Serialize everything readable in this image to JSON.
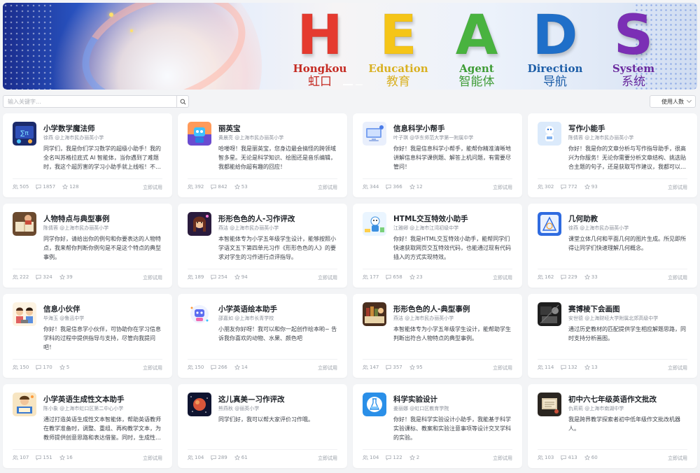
{
  "banner": {
    "letters": [
      {
        "big": "H",
        "en": "Hongkou",
        "zh": "虹口",
        "color": "#e53a2f",
        "en_color": "#c42a22",
        "zh_color": "#c42a22"
      },
      {
        "big": "E",
        "en": "Education",
        "zh": "教育",
        "color": "#f5c518",
        "en_color": "#d9b020",
        "zh_color": "#d9b020"
      },
      {
        "big": "A",
        "en": "Agent",
        "zh": "智能体",
        "color": "#49b33f",
        "en_color": "#3f9c36",
        "zh_color": "#3f9c36"
      },
      {
        "big": "D",
        "en": "Direction",
        "zh": "导航",
        "color": "#1f6fc9",
        "en_color": "#1d5ea8",
        "zh_color": "#1d5ea8"
      },
      {
        "big": "S",
        "en": "System",
        "zh": "系统",
        "color": "#7b2fb5",
        "en_color": "#6a2a9e",
        "zh_color": "#6a2a9e"
      }
    ]
  },
  "search": {
    "placeholder": "输入关键字..."
  },
  "sort": {
    "label": "使用人数"
  },
  "try_label": "立即试用",
  "cards": [
    {
      "title": "小学数学魔法师",
      "author": "徐燕 @上海市民办丽英小学",
      "desc": "同学们，我是你们学习数学的超级小助手！我的全名叫苏格拉底式 AI 智能体，当你遇到了难题时，我这个超厉害的学习小助手就上线啦！不过...",
      "views": "505",
      "msgs": "1857",
      "stars": "128",
      "icon": "math"
    },
    {
      "title": "丽英宝",
      "author": "黄晨亮 @上海市民办丽英小学",
      "desc": "哈喽呀！我是丽英宝，您身边最会搞怪的跨领域智多星。无论是科学知识、绘图还是音乐编辑，我都能给你超有趣的回应！",
      "views": "392",
      "msgs": "842",
      "stars": "53",
      "icon": "robot"
    },
    {
      "title": "信息科学小帮手",
      "author": "叶子琪 @华东师范大学第一附属中学",
      "desc": "你好！我是信息科学小帮手，能帮你精准清晰地讲解信息科学课例题、解答上机问题，有需要尽管问！",
      "views": "344",
      "msgs": "366",
      "stars": "12",
      "icon": "infosci"
    },
    {
      "title": "写作小能手",
      "author": "陈倩蓉 @上海市民办丽英小学",
      "desc": "你好！我是你的文章分析与写作指导助手，很高兴为你服务！无论你需要分析文章结构、挑选贴合主题的句子，还是获取写作建议，我都可以帮...",
      "views": "302",
      "msgs": "772",
      "stars": "93",
      "icon": "writer"
    },
    {
      "title": "人物特点与典型事例",
      "author": "陈倩蓉 @上海市民办丽英小学",
      "desc": "同学你好，请给出你的例句和你要表达的人物特点，我来帮你判断你例句是不是这个特点的典型事例。",
      "views": "222",
      "msgs": "324",
      "stars": "39",
      "icon": "book"
    },
    {
      "title": "形形色色的人-习作评改",
      "author": "燕洁 @上海市民办丽英小学",
      "desc": "本智能体专为小学五年级学生设计，能够按照小学语文五下第四单元习作《形形色色的人》的要求对学生的习作进行点评指导。",
      "views": "189",
      "msgs": "254",
      "stars": "94",
      "icon": "girl"
    },
    {
      "title": "HTML交互特效小助手",
      "author": "江雅卿 @上海市江湾初级中学",
      "desc": "你好！我是HTML交互特效小助手，能帮同学们快速获取网页交互特效代码，也能通过现有代码插入的方式实现特效。",
      "views": "177",
      "msgs": "658",
      "stars": "23",
      "icon": "html"
    },
    {
      "title": "几何助教",
      "author": "徐燕 @上海市民办丽英小学",
      "desc": "课堂立体几何和平面几何的图片生成。所见即所得让同学们快速理解几何概念。",
      "views": "162",
      "msgs": "229",
      "stars": "33",
      "icon": "geo"
    },
    {
      "title": "信息小伙伴",
      "author": "毕海玉 @鲁迅中学",
      "desc": "你好！我是信息学小伙伴，可协助你在学习信息学科的过程中提供指导与支持，尽管向我提问吧！",
      "views": "150",
      "msgs": "170",
      "stars": "5",
      "icon": "kids"
    },
    {
      "title": "小学英语绘本助手",
      "author": "邵嘉如 @上海市长青学校",
      "desc": "小朋友你好呀！我可以和你一起创作绘本哟~ 告诉我你喜欢的动物、水果、颜色吧",
      "views": "150",
      "msgs": "266",
      "stars": "14",
      "icon": "bot2"
    },
    {
      "title": "形形色色的人-典型事例",
      "author": "燕洁 @上海市民办丽英小学",
      "desc": "本智能体专为小学五年级学生设计，能帮助学生判断出符合人物特点的典型事例。",
      "views": "147",
      "msgs": "357",
      "stars": "95",
      "icon": "books"
    },
    {
      "title": "赛博棱下会画图",
      "author": "安世德 @上海财经大学附属北郊高级中学",
      "desc": "通过历史教材的匹配提供学生相应解题思路，同时支持分析画图。",
      "views": "114",
      "msgs": "132",
      "stars": "13",
      "icon": "dark"
    },
    {
      "title": "小学英语生成性文本助手",
      "author": "陈小象 @上海市虹口区第二中心小学",
      "desc": "通过打造英语生成性文本智能体，帮助英语教师在教学准备时，调整、重组、再构教学文本，为教师提供创意思路和表达借鉴。同时，生成性文...",
      "views": "107",
      "msgs": "151",
      "stars": "16",
      "icon": "reader"
    },
    {
      "title": "这儿真美—习作评改",
      "author": "熊燕秋 @丽英小学",
      "desc": "同学们好，我可以帮大家评价习作哦。",
      "views": "104",
      "msgs": "289",
      "stars": "61",
      "icon": "space"
    },
    {
      "title": "科学实验设计",
      "author": "姜丽娜 @虹口区教育学院",
      "desc": "你好！我是科学实验设计小助手，我能基于科学实验课标、教案和实验注意事项等设计交叉学科的实验。",
      "views": "104",
      "msgs": "122",
      "stars": "2",
      "icon": "lab"
    },
    {
      "title": "初中六七年级英语作文批改",
      "author": "仇莉莉 @上海市南湖中学",
      "desc": "我是跨界教学探索者初中低年级作文批改机器人。",
      "views": "103",
      "msgs": "413",
      "stars": "60",
      "icon": "dark2"
    }
  ]
}
